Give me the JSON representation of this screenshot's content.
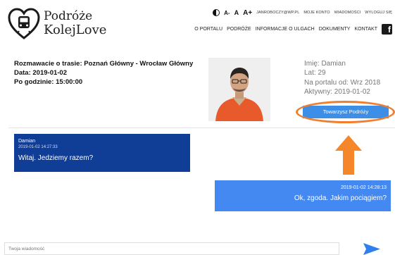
{
  "brand": {
    "line1": "Podróże",
    "line2": "KolejLove"
  },
  "topbar": {
    "font_small": "A-",
    "font_medium": "A",
    "font_large": "A+",
    "user_email": "JANROBOCZY@WP.PL",
    "my_account": "MOJE KONTO",
    "messages": "WIADOMOŚCI",
    "logout": "WYLOGUJ SIĘ"
  },
  "nav": {
    "about": "O PORTALU",
    "trips": "PODRÓŻE",
    "discounts": "INFORMACJE O ULGACH",
    "documents": "DOKUMENTY",
    "contact": "KONTAKT"
  },
  "trip": {
    "title": "Rozmawacie o trasie: Poznań Główny - Wrocław Główny",
    "date": "Data: 2019-01-02",
    "time": "Po godzinie: 15:00:00"
  },
  "profile": {
    "name": "Imię: Damian",
    "age": "Lat: 29",
    "since": "Na portalu od: Wrz 2018",
    "active": "Aktywny: 2019-01-02",
    "button": "Towarzysz Podróży"
  },
  "messages": {
    "incoming": {
      "author": "Damian",
      "timestamp": "2019-01-02 14:27:33",
      "text": "Witaj. Jedziemy razem?"
    },
    "outgoing": {
      "timestamp": "2019-01-02 14:28:13",
      "text": "Ok, zgoda. Jakim pociągiem?"
    }
  },
  "compose": {
    "placeholder": "Twoja wiadomość",
    "value": ""
  },
  "icons": {
    "logo": "heart-train-icon",
    "contrast": "contrast-icon",
    "facebook": "facebook-icon",
    "send": "send-icon",
    "arrow": "arrow-up-annotation"
  },
  "colors": {
    "accent": "#3d8ee6",
    "incoming_bubble": "#103e96",
    "outgoing_bubble": "#4488f2",
    "annotation": "#ef7f2f"
  }
}
